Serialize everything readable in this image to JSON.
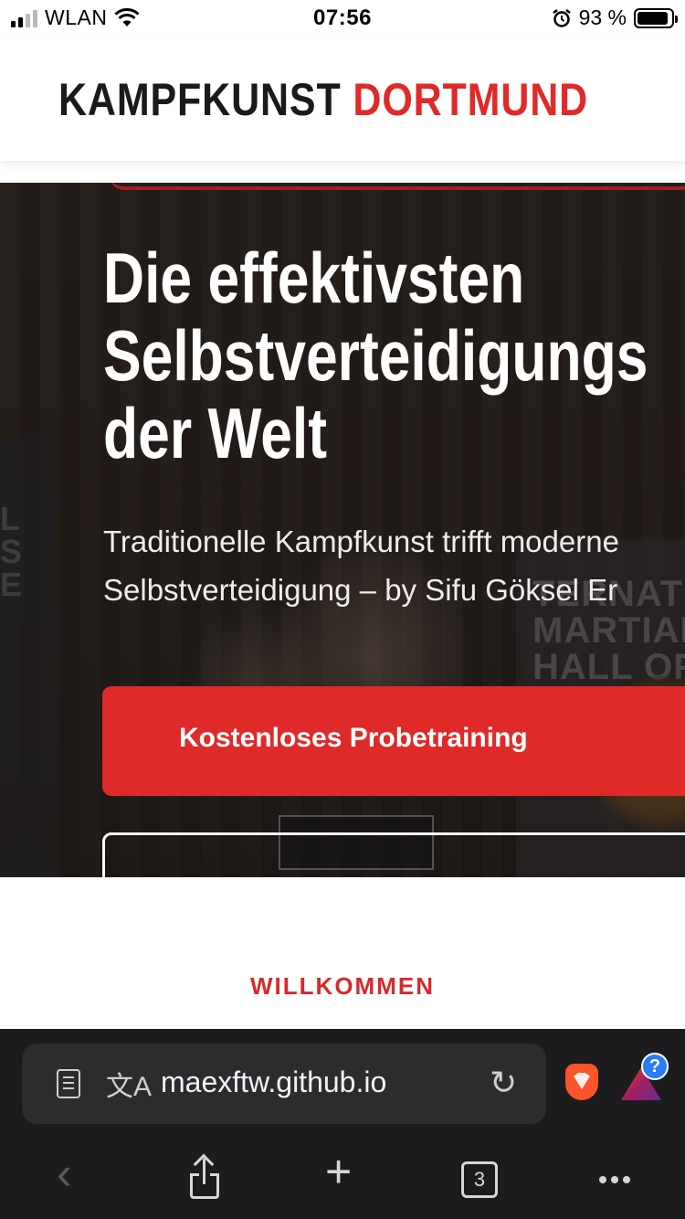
{
  "status_bar": {
    "carrier": "WLAN",
    "time": "07:56",
    "battery_percent": "93 %",
    "battery_level": 0.93,
    "signal_bars": 2
  },
  "site": {
    "brand_part1": "KAMPFKUNST",
    "brand_part2": "DORTMUND",
    "accent_color": "#e02a2a"
  },
  "hero": {
    "title_line1": "Die effektivsten",
    "title_line2": "Selbstverteidigungs",
    "title_line3": "der Welt",
    "subtitle_line1": "Traditionelle Kampfkunst trifft moderne",
    "subtitle_line2": "Selbstverteidigung – by Sifu Göksel Er",
    "primary_button": "Kostenloses Probetraining",
    "secondary_button": "",
    "banner_right_text": "TERNAT\nMARTIAL\nHALL OF",
    "banner_left_text": "L\nS\nE"
  },
  "welcome": {
    "label": "WILLKOMMEN"
  },
  "browser": {
    "url": "maexftw.github.io",
    "translate_glyph": "文A",
    "reload_glyph": "↻",
    "tab_count": "3",
    "rewards_badge": "?",
    "back_glyph": "‹",
    "new_tab_glyph": "+"
  }
}
